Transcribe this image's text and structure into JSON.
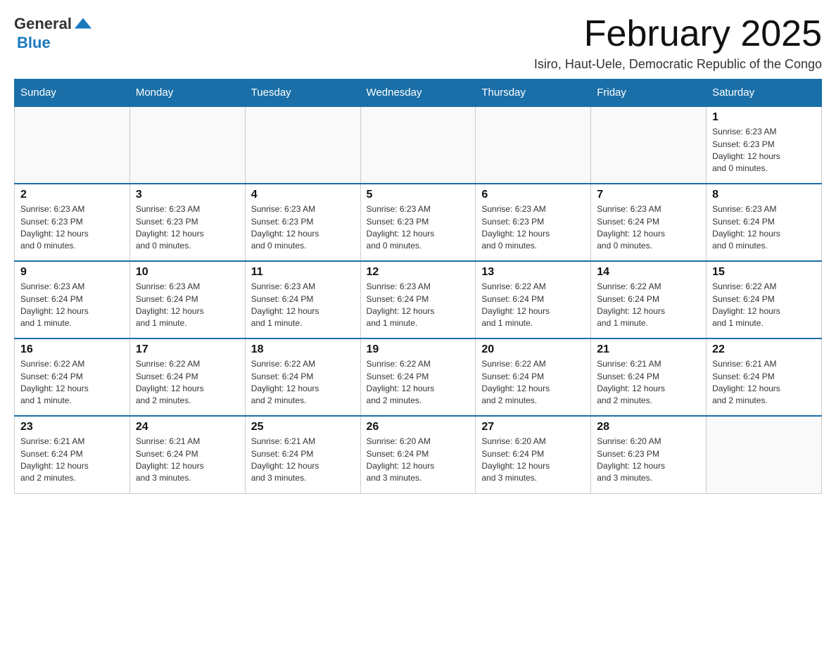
{
  "logo": {
    "text_general": "General",
    "text_blue": "Blue",
    "tagline": ""
  },
  "header": {
    "title": "February 2025",
    "subtitle": "Isiro, Haut-Uele, Democratic Republic of the Congo"
  },
  "days_of_week": [
    "Sunday",
    "Monday",
    "Tuesday",
    "Wednesday",
    "Thursday",
    "Friday",
    "Saturday"
  ],
  "weeks": [
    {
      "cells": [
        {
          "day": "",
          "info": ""
        },
        {
          "day": "",
          "info": ""
        },
        {
          "day": "",
          "info": ""
        },
        {
          "day": "",
          "info": ""
        },
        {
          "day": "",
          "info": ""
        },
        {
          "day": "",
          "info": ""
        },
        {
          "day": "1",
          "info": "Sunrise: 6:23 AM\nSunset: 6:23 PM\nDaylight: 12 hours\nand 0 minutes."
        }
      ]
    },
    {
      "cells": [
        {
          "day": "2",
          "info": "Sunrise: 6:23 AM\nSunset: 6:23 PM\nDaylight: 12 hours\nand 0 minutes."
        },
        {
          "day": "3",
          "info": "Sunrise: 6:23 AM\nSunset: 6:23 PM\nDaylight: 12 hours\nand 0 minutes."
        },
        {
          "day": "4",
          "info": "Sunrise: 6:23 AM\nSunset: 6:23 PM\nDaylight: 12 hours\nand 0 minutes."
        },
        {
          "day": "5",
          "info": "Sunrise: 6:23 AM\nSunset: 6:23 PM\nDaylight: 12 hours\nand 0 minutes."
        },
        {
          "day": "6",
          "info": "Sunrise: 6:23 AM\nSunset: 6:23 PM\nDaylight: 12 hours\nand 0 minutes."
        },
        {
          "day": "7",
          "info": "Sunrise: 6:23 AM\nSunset: 6:24 PM\nDaylight: 12 hours\nand 0 minutes."
        },
        {
          "day": "8",
          "info": "Sunrise: 6:23 AM\nSunset: 6:24 PM\nDaylight: 12 hours\nand 0 minutes."
        }
      ]
    },
    {
      "cells": [
        {
          "day": "9",
          "info": "Sunrise: 6:23 AM\nSunset: 6:24 PM\nDaylight: 12 hours\nand 1 minute."
        },
        {
          "day": "10",
          "info": "Sunrise: 6:23 AM\nSunset: 6:24 PM\nDaylight: 12 hours\nand 1 minute."
        },
        {
          "day": "11",
          "info": "Sunrise: 6:23 AM\nSunset: 6:24 PM\nDaylight: 12 hours\nand 1 minute."
        },
        {
          "day": "12",
          "info": "Sunrise: 6:23 AM\nSunset: 6:24 PM\nDaylight: 12 hours\nand 1 minute."
        },
        {
          "day": "13",
          "info": "Sunrise: 6:22 AM\nSunset: 6:24 PM\nDaylight: 12 hours\nand 1 minute."
        },
        {
          "day": "14",
          "info": "Sunrise: 6:22 AM\nSunset: 6:24 PM\nDaylight: 12 hours\nand 1 minute."
        },
        {
          "day": "15",
          "info": "Sunrise: 6:22 AM\nSunset: 6:24 PM\nDaylight: 12 hours\nand 1 minute."
        }
      ]
    },
    {
      "cells": [
        {
          "day": "16",
          "info": "Sunrise: 6:22 AM\nSunset: 6:24 PM\nDaylight: 12 hours\nand 1 minute."
        },
        {
          "day": "17",
          "info": "Sunrise: 6:22 AM\nSunset: 6:24 PM\nDaylight: 12 hours\nand 2 minutes."
        },
        {
          "day": "18",
          "info": "Sunrise: 6:22 AM\nSunset: 6:24 PM\nDaylight: 12 hours\nand 2 minutes."
        },
        {
          "day": "19",
          "info": "Sunrise: 6:22 AM\nSunset: 6:24 PM\nDaylight: 12 hours\nand 2 minutes."
        },
        {
          "day": "20",
          "info": "Sunrise: 6:22 AM\nSunset: 6:24 PM\nDaylight: 12 hours\nand 2 minutes."
        },
        {
          "day": "21",
          "info": "Sunrise: 6:21 AM\nSunset: 6:24 PM\nDaylight: 12 hours\nand 2 minutes."
        },
        {
          "day": "22",
          "info": "Sunrise: 6:21 AM\nSunset: 6:24 PM\nDaylight: 12 hours\nand 2 minutes."
        }
      ]
    },
    {
      "cells": [
        {
          "day": "23",
          "info": "Sunrise: 6:21 AM\nSunset: 6:24 PM\nDaylight: 12 hours\nand 2 minutes."
        },
        {
          "day": "24",
          "info": "Sunrise: 6:21 AM\nSunset: 6:24 PM\nDaylight: 12 hours\nand 3 minutes."
        },
        {
          "day": "25",
          "info": "Sunrise: 6:21 AM\nSunset: 6:24 PM\nDaylight: 12 hours\nand 3 minutes."
        },
        {
          "day": "26",
          "info": "Sunrise: 6:20 AM\nSunset: 6:24 PM\nDaylight: 12 hours\nand 3 minutes."
        },
        {
          "day": "27",
          "info": "Sunrise: 6:20 AM\nSunset: 6:24 PM\nDaylight: 12 hours\nand 3 minutes."
        },
        {
          "day": "28",
          "info": "Sunrise: 6:20 AM\nSunset: 6:23 PM\nDaylight: 12 hours\nand 3 minutes."
        },
        {
          "day": "",
          "info": ""
        }
      ]
    }
  ]
}
